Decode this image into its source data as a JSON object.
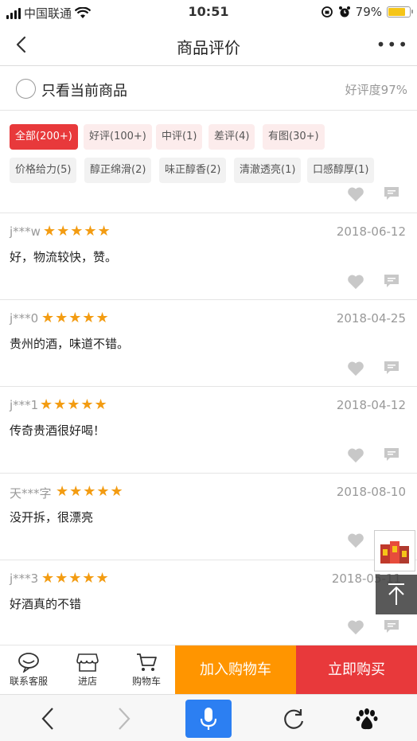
{
  "status_bar": {
    "carrier": "中国联通",
    "time": "10:51",
    "battery": "79%",
    "battery_level": 0.79
  },
  "nav": {
    "title": "商品评价",
    "more": "•••"
  },
  "filter": {
    "only_current_label": "只看当前商品",
    "positive_rate": "好评度97%"
  },
  "tags": [
    {
      "label": "全部(200+)",
      "active": true
    },
    {
      "label": "好评(100+)"
    },
    {
      "label": "中评(1)"
    },
    {
      "label": "差评(4)"
    },
    {
      "label": "有图(30+)"
    },
    {
      "label": "价格给力(5)"
    },
    {
      "label": "醇正绵滑(2)"
    },
    {
      "label": "味正醇香(2)"
    },
    {
      "label": "清澈透亮(1)"
    },
    {
      "label": "口感醇厚(1)"
    }
  ],
  "reviews": [
    {
      "user": "j***w",
      "stars": "★★★★★",
      "date": "2018-06-12",
      "content": "好，物流较快，赞。"
    },
    {
      "user": "j***0",
      "stars": "★★★★★",
      "date": "2018-04-25",
      "content": "贵州的酒，味道不错。"
    },
    {
      "user": "j***1",
      "stars": "★★★★★",
      "date": "2018-04-12",
      "content": "传奇贵酒很好喝！"
    },
    {
      "user": "天***字",
      "stars": "★★★★★",
      "date": "2018-08-10",
      "content": "没开拆，很漂亮"
    },
    {
      "user": "j***3",
      "stars": "★★★★★",
      "date": "2018-05-11",
      "content": "好酒真的不错"
    }
  ],
  "cart_bar": {
    "service": "联系客服",
    "store": "进店",
    "cart": "购物车",
    "add_to_cart": "加入购物车",
    "buy_now": "立即购买"
  },
  "colors": {
    "accent_red": "#e8393b",
    "accent_orange": "#ff9500",
    "star": "#f39c12",
    "browser_blue": "#2c7ff2"
  }
}
